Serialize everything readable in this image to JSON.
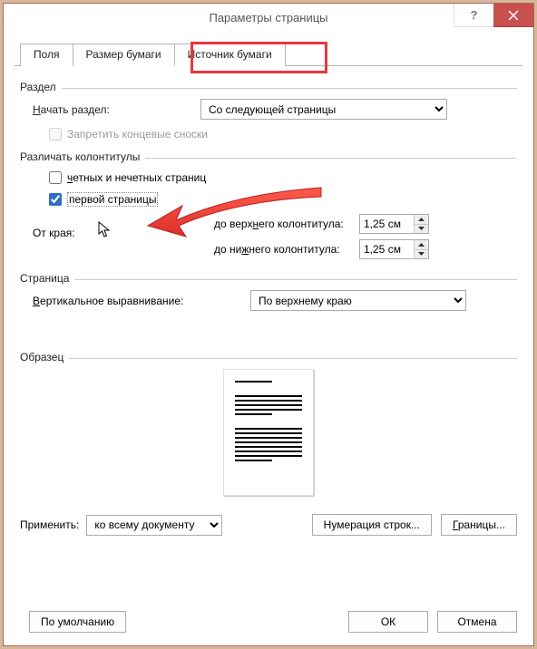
{
  "window": {
    "title": "Параметры страницы"
  },
  "tabs": {
    "fields": "Поля",
    "size": "Размер бумаги",
    "source": "Источник бумаги"
  },
  "section": {
    "group": "Раздел",
    "start_label_pre": "Н",
    "start_label_post": "ачать раздел:",
    "start_value": "Со следующей страницы",
    "suppress": "Запретить концевые сноски"
  },
  "headers": {
    "group": "Различать колонтитулы",
    "odd_even_pre": "ч",
    "odd_even_post": "етных и нечетных страниц",
    "first_page": "первой страницы",
    "from_edge": "От края:",
    "header_pre": "до верх",
    "header_u": "н",
    "header_post": "его колонтитула:",
    "footer_pre": "до ни",
    "footer_u": "ж",
    "footer_post": "него колонтитула:",
    "header_val": "1,25 см",
    "footer_val": "1,25 см"
  },
  "page": {
    "group": "Страница",
    "valign_pre": "В",
    "valign_post": "ертикальное выравнивание:",
    "valign_value": "По верхнему краю"
  },
  "preview": {
    "group": "Образец"
  },
  "apply": {
    "label": "Применить:",
    "value": "ко всему документу",
    "line_numbers": "Нумерация строк...",
    "borders_pre": "Г",
    "borders_post": "раницы..."
  },
  "footer": {
    "default": "По умолчанию",
    "ok": "ОК",
    "cancel": "Отмена"
  }
}
